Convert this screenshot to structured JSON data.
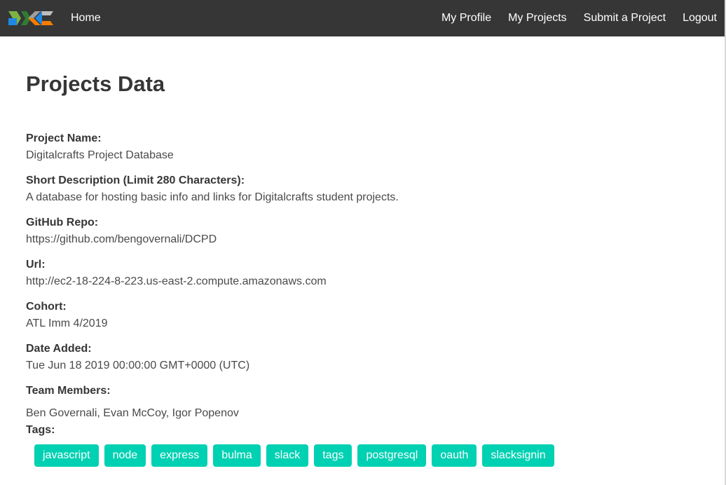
{
  "nav": {
    "home": "Home",
    "my_profile": "My Profile",
    "my_projects": "My Projects",
    "submit_project": "Submit a Project",
    "logout": "Logout"
  },
  "page": {
    "title": "Projects Data"
  },
  "fields": [
    {
      "label": "Project Name:",
      "value": "Digitalcrafts Project Database"
    },
    {
      "label": "Short Description (Limit 280 Characters):",
      "value": "A database for hosting basic info and links for Digitalcrafts student projects."
    },
    {
      "label": "GitHub Repo:",
      "value": "https://github.com/bengovernali/DCPD"
    },
    {
      "label": "Url:",
      "value": "http://ec2-18-224-8-223.us-east-2.compute.amazonaws.com"
    },
    {
      "label": "Cohort:",
      "value": "ATL Imm 4/2019"
    },
    {
      "label": "Date Added:",
      "value": "Tue Jun 18 2019 00:00:00 GMT+0000 (UTC)"
    }
  ],
  "team": {
    "label": "Team Members:",
    "value": "Ben Governali, Evan McCoy, Igor Popenov"
  },
  "tags": {
    "label": "Tags:",
    "items": [
      "javascript",
      "node",
      "express",
      "bulma",
      "slack",
      "tags",
      "postgresql",
      "oauth",
      "slacksignin"
    ]
  },
  "colors": {
    "navbar": "#363636",
    "tag": "#00d1b2",
    "logo_green": "#7cb342",
    "logo_blue": "#1e88e5",
    "logo_orange": "#f57c00",
    "logo_gray": "#9e9e9e"
  }
}
